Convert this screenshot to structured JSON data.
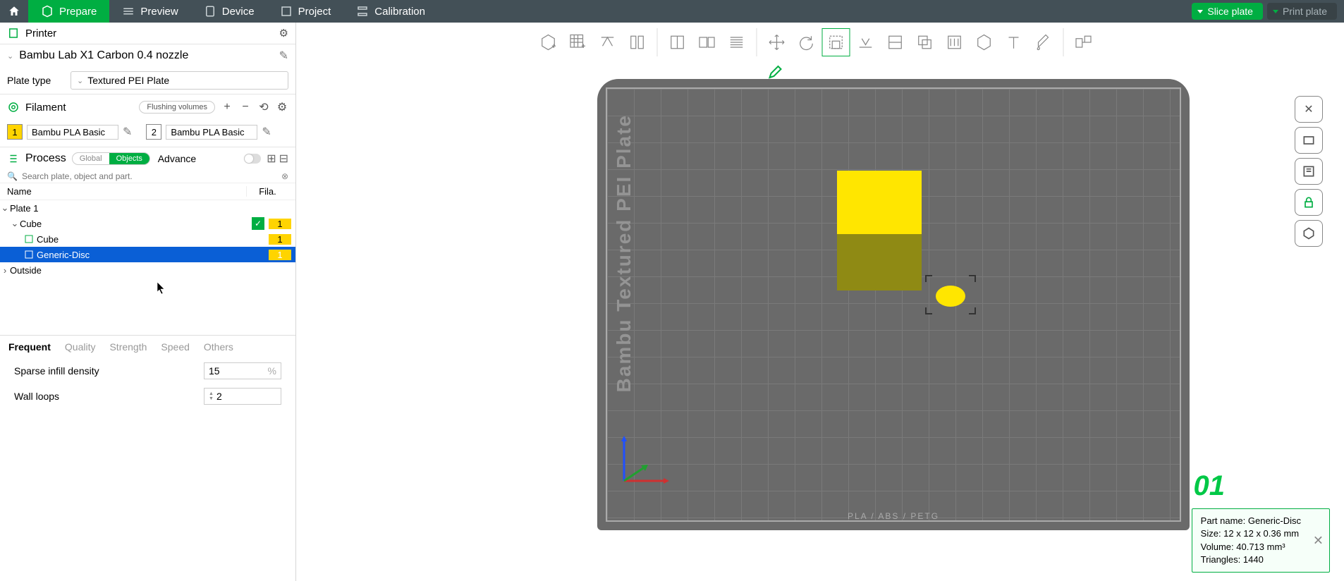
{
  "menu": {
    "prepare": "Prepare",
    "preview": "Preview",
    "device": "Device",
    "project": "Project",
    "calibration": "Calibration",
    "slice": "Slice plate",
    "print": "Print plate"
  },
  "printer": {
    "section": "Printer",
    "name": "Bambu Lab X1 Carbon 0.4 nozzle",
    "plate_type_lbl": "Plate type",
    "plate_type": "Textured PEI Plate"
  },
  "filament": {
    "section": "Filament",
    "flushing": "Flushing volumes",
    "items": [
      {
        "num": "1",
        "name": "Bambu PLA Basic"
      },
      {
        "num": "2",
        "name": "Bambu PLA Basic"
      }
    ]
  },
  "process": {
    "section": "Process",
    "global": "Global",
    "objects": "Objects",
    "advance": "Advance"
  },
  "search": {
    "placeholder": "Search plate, object and part."
  },
  "tree": {
    "col_name": "Name",
    "col_fila": "Fila.",
    "plate1": "Plate 1",
    "cube_parent": "Cube",
    "cube_child": "Cube",
    "disc": "Generic-Disc",
    "outside": "Outside",
    "fila_val": "1"
  },
  "settings": {
    "tabs": {
      "frequent": "Frequent",
      "quality": "Quality",
      "strength": "Strength",
      "speed": "Speed",
      "others": "Others"
    },
    "infill_lbl": "Sparse infill density",
    "infill_val": "15",
    "infill_unit": "%",
    "walls_lbl": "Wall loops",
    "walls_val": "2"
  },
  "plate": {
    "label": "Bambu Textured PEI Plate",
    "number": "01",
    "footer": "PLA / ABS / PETG"
  },
  "info": {
    "l1": "Part name: Generic-Disc",
    "l2": "Size: 12 x 12 x 0.36 mm",
    "l3": "Volume: 40.713 mm³",
    "l4": "Triangles: 1440"
  }
}
